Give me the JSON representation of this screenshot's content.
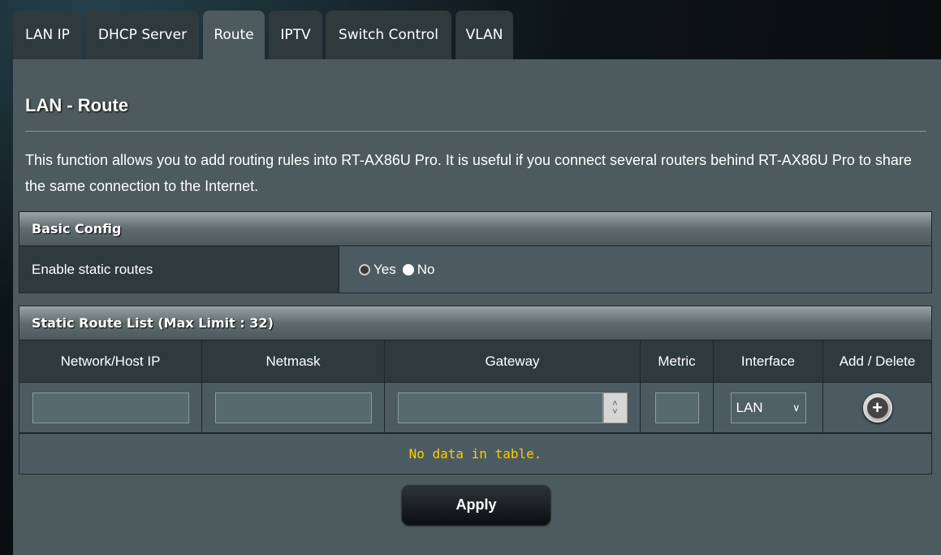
{
  "tabs": [
    {
      "label": "LAN IP"
    },
    {
      "label": "DHCP Server"
    },
    {
      "label": "Route",
      "active": true
    },
    {
      "label": "IPTV"
    },
    {
      "label": "Switch Control"
    },
    {
      "label": "VLAN"
    }
  ],
  "page": {
    "title": "LAN - Route",
    "description": "This function allows you to add routing rules into RT-AX86U Pro. It is useful if you connect several routers behind RT-AX86U Pro to share the same connection to the Internet."
  },
  "basic_config": {
    "header": "Basic Config",
    "label": "Enable static routes",
    "options": [
      {
        "label": "Yes",
        "selected": false
      },
      {
        "label": "No",
        "selected": true
      }
    ]
  },
  "route_list": {
    "header": "Static Route List (Max Limit : 32)",
    "columns": [
      "Network/Host IP",
      "Netmask",
      "Gateway",
      "Metric",
      "Interface",
      "Add / Delete"
    ],
    "inputs": {
      "network": "",
      "netmask": "",
      "gateway": "",
      "metric": "",
      "interface": "LAN"
    },
    "empty_text": "No data in table.",
    "empty_color": "#ffcc00"
  },
  "apply_label": "Apply"
}
